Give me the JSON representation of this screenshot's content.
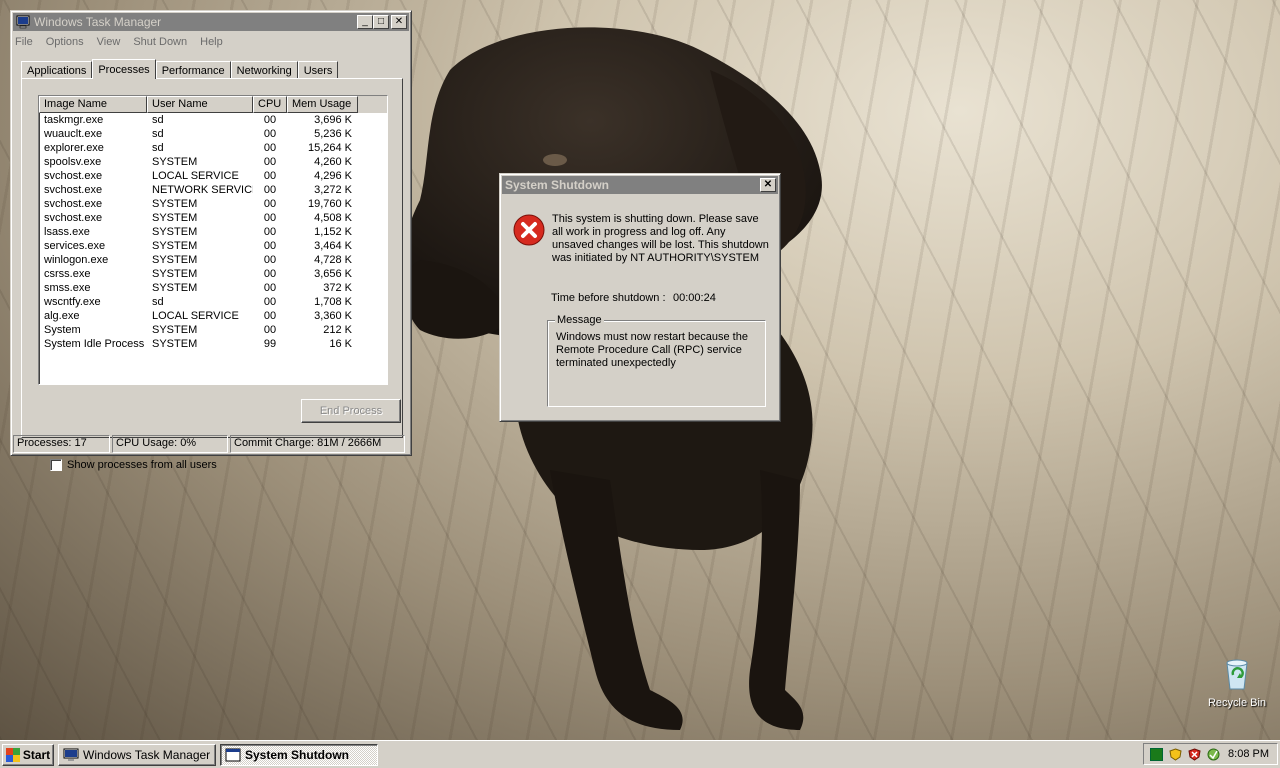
{
  "taskmgr": {
    "title": "Windows Task Manager",
    "menu": [
      "File",
      "Options",
      "View",
      "Shut Down",
      "Help"
    ],
    "tabs": [
      "Applications",
      "Processes",
      "Performance",
      "Networking",
      "Users"
    ],
    "selected_tab": "Processes",
    "columns": [
      "Image Name",
      "User Name",
      "CPU",
      "Mem Usage"
    ],
    "processes": [
      {
        "image": "taskmgr.exe",
        "user": "sd",
        "cpu": "00",
        "mem": "3,696 K"
      },
      {
        "image": "wuauclt.exe",
        "user": "sd",
        "cpu": "00",
        "mem": "5,236 K"
      },
      {
        "image": "explorer.exe",
        "user": "sd",
        "cpu": "00",
        "mem": "15,264 K"
      },
      {
        "image": "spoolsv.exe",
        "user": "SYSTEM",
        "cpu": "00",
        "mem": "4,260 K"
      },
      {
        "image": "svchost.exe",
        "user": "LOCAL SERVICE",
        "cpu": "00",
        "mem": "4,296 K"
      },
      {
        "image": "svchost.exe",
        "user": "NETWORK SERVICE",
        "cpu": "00",
        "mem": "3,272 K"
      },
      {
        "image": "svchost.exe",
        "user": "SYSTEM",
        "cpu": "00",
        "mem": "19,760 K"
      },
      {
        "image": "svchost.exe",
        "user": "SYSTEM",
        "cpu": "00",
        "mem": "4,508 K"
      },
      {
        "image": "lsass.exe",
        "user": "SYSTEM",
        "cpu": "00",
        "mem": "1,152 K"
      },
      {
        "image": "services.exe",
        "user": "SYSTEM",
        "cpu": "00",
        "mem": "3,464 K"
      },
      {
        "image": "winlogon.exe",
        "user": "SYSTEM",
        "cpu": "00",
        "mem": "4,728 K"
      },
      {
        "image": "csrss.exe",
        "user": "SYSTEM",
        "cpu": "00",
        "mem": "3,656 K"
      },
      {
        "image": "smss.exe",
        "user": "SYSTEM",
        "cpu": "00",
        "mem": "372 K"
      },
      {
        "image": "wscntfy.exe",
        "user": "sd",
        "cpu": "00",
        "mem": "1,708 K"
      },
      {
        "image": "alg.exe",
        "user": "LOCAL SERVICE",
        "cpu": "00",
        "mem": "3,360 K"
      },
      {
        "image": "System",
        "user": "SYSTEM",
        "cpu": "00",
        "mem": "212 K"
      },
      {
        "image": "System Idle Process",
        "user": "SYSTEM",
        "cpu": "99",
        "mem": "16 K"
      }
    ],
    "show_all_label": "Show processes from all users",
    "show_all_checked": false,
    "end_process_label": "End Process",
    "status": {
      "processes": "Processes: 17",
      "cpu": "CPU Usage: 0%",
      "commit": "Commit Charge: 81M / 2666M"
    }
  },
  "shutdown": {
    "title": "System Shutdown",
    "message": "This system is shutting down. Please save all work in progress and log off. Any unsaved changes will be lost. This shutdown was initiated by NT AUTHORITY\\SYSTEM",
    "time_label": "Time before shutdown :",
    "time_value": "00:00:24",
    "group_label": "Message",
    "group_text": "Windows must now restart because the Remote Procedure Call (RPC) service terminated unexpectedly"
  },
  "desktop": {
    "recycle_bin_label": "Recycle Bin"
  },
  "taskbar": {
    "start_label": "Start",
    "buttons": [
      "Windows Task Manager",
      "System Shutdown"
    ],
    "active_button": "System Shutdown",
    "clock": "8:08 PM"
  },
  "colors": {
    "window_face": "#d4d0c8",
    "inactive_title": "#808080",
    "error_red": "#d62a1f"
  }
}
